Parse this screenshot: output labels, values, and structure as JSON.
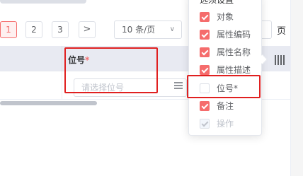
{
  "pagination": {
    "pages": [
      "1",
      "2",
      "3"
    ],
    "active_page": "1",
    "next_icon": "chevron-right-icon",
    "next_label": ">",
    "page_size": "10 条/页",
    "page_size_caret": "∨",
    "page_suffix": "页"
  },
  "table": {
    "column_title": "位号",
    "required_mark": "*",
    "position_placeholder": "请选择位号"
  },
  "column_settings": {
    "icon": "column-settings-icon",
    "title": "选须设直",
    "options": [
      {
        "label": "对象",
        "checked": true,
        "disabled": false
      },
      {
        "label": "属性编码",
        "checked": true,
        "disabled": false
      },
      {
        "label": "属性名称",
        "checked": true,
        "disabled": false
      },
      {
        "label": "属性描述",
        "checked": true,
        "disabled": false
      },
      {
        "label": "位号*",
        "checked": false,
        "disabled": false
      },
      {
        "label": "备注",
        "checked": true,
        "disabled": false
      },
      {
        "label": "操作",
        "checked": true,
        "disabled": true
      }
    ]
  },
  "colors": {
    "accent": "#f56c6c",
    "highlight": "#e02020",
    "header_bg": "#e8eaf2"
  }
}
